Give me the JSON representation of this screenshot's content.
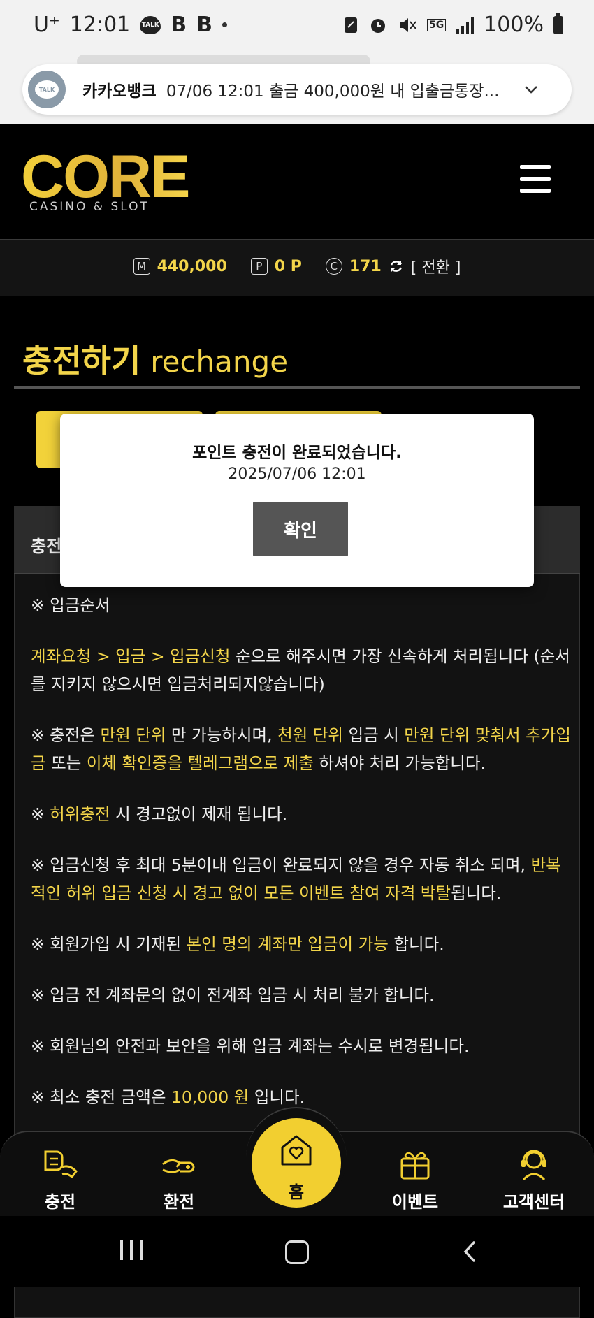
{
  "status_bar": {
    "time": "12:01",
    "carrier": "U⁺",
    "battery": "100%",
    "network": "5G",
    "b1": "B",
    "b2": "B"
  },
  "notification": {
    "app": "카카오뱅크",
    "text": "07/06 12:01 출금 400,000원 내 입출금통장...",
    "icon_label": "TALK"
  },
  "header": {
    "logo_main": "CORE",
    "logo_sub": "CASINO & SLOT"
  },
  "balance": {
    "money_icon": "M",
    "money": "440,000",
    "point_icon": "P",
    "points": "0 P",
    "coin_icon": "C",
    "coins": "171",
    "convert": "[ 전환 ]"
  },
  "page": {
    "title_ko": "충전하기",
    "title_en": "rechange",
    "panel_label": "충전"
  },
  "content": {
    "order_heading": "※ 입금순서",
    "p1_hl": "계좌요청 > 입금 > 입금신청",
    "p1_rest": " 순으로 해주시면 가장 신속하게 처리됩니다 (순서를 지키지 않으시면 입금처리되지않습니다)",
    "p2_a": "※ 충전은 ",
    "p2_b": "만원 단위",
    "p2_c": " 만 가능하시며, ",
    "p2_d": "천원 단위",
    "p2_e": " 입금 시 ",
    "p2_f": "만원 단위 맞춰서 추가입금",
    "p2_g": " 또는 ",
    "p2_h": "이체 확인증을 텔레그램으로 제출",
    "p2_i": " 하셔야 처리 가능합니다.",
    "p3_a": "※ ",
    "p3_b": "허위충전",
    "p3_c": " 시 경고없이 제재 됩니다.",
    "p4_a": "※ 입금신청 후 최대 5분이내 입금이 완료되지 않을 경우 자동 취소 되며, ",
    "p4_b": "반복적인 허위 입금 신청 시 경고 없이 모든 이벤트 참여 자격 박탈",
    "p4_c": "됩니다.",
    "p5_a": "※ 회원가입 시 기재된 ",
    "p5_b": "본인 명의 계좌만 입금이 가능",
    "p5_c": " 합니다.",
    "p6": "※ 입금 전 계좌문의 없이 전계좌 입금 시 처리 불가 합니다.",
    "p7": "※ 회원님의 안전과 보안을 위해 입금 계좌는 수시로 변경됩니다.",
    "p8_a": "※ 최소 충전 금액은 ",
    "p8_b": "10,000 원",
    "p8_c": " 입니다."
  },
  "modal": {
    "message": "포인트 충전이 완료되었습니다.",
    "datetime": "2025/07/06 12:01",
    "confirm": "확인"
  },
  "bottom_nav": {
    "charge": "충전",
    "exchange": "환전",
    "home": "홈",
    "event": "이벤트",
    "support": "고객센터"
  },
  "colors": {
    "accent": "#f3d54a",
    "background": "#000000",
    "modal_button": "#555555"
  }
}
